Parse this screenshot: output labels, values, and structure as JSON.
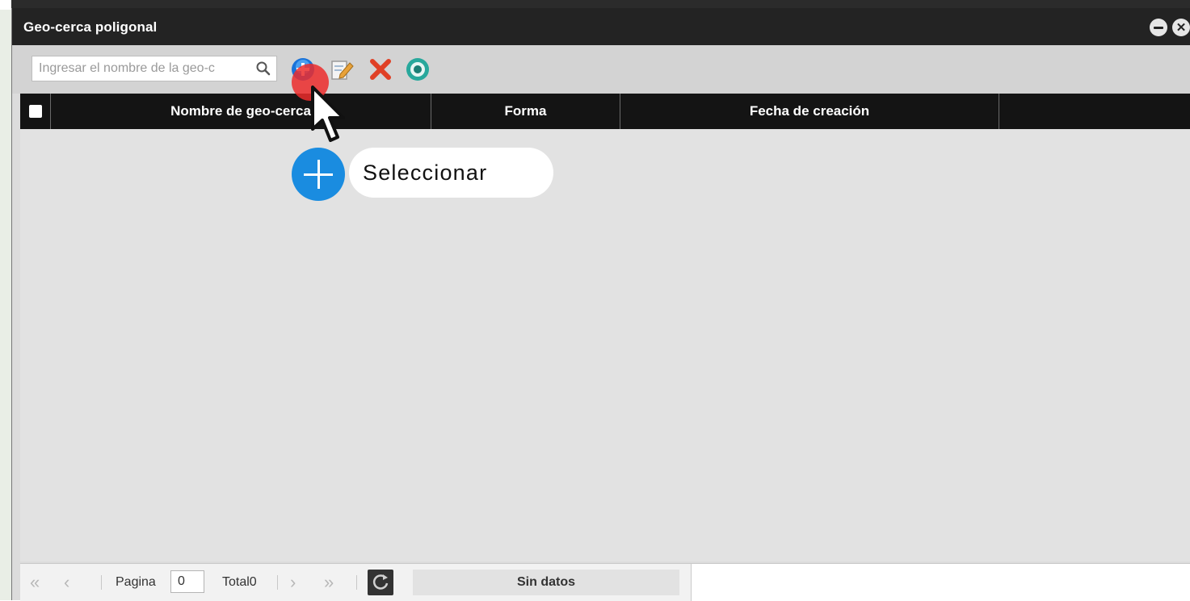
{
  "window": {
    "title": "Geo-cerca poligonal"
  },
  "toolbar": {
    "search_placeholder": "Ingresar el nombre de la geo-c",
    "icons": [
      "add-icon",
      "edit-icon",
      "delete-icon",
      "view-icon"
    ],
    "accent_colors": {
      "add": "#1a73d9",
      "delete": "#e04025",
      "view": "#28a89c"
    }
  },
  "table": {
    "columns": [
      "Nombre de geo-cerca",
      "Forma",
      "Fecha de creación",
      ""
    ],
    "rows": []
  },
  "pager": {
    "page_label": "Pagina",
    "page_value": "0",
    "total_label": "Total0",
    "status": "Sin datos"
  },
  "tutorial": {
    "label": "Seleccionar",
    "button_color": "#1a8ce0",
    "highlight_color": "#ec2c2c"
  }
}
